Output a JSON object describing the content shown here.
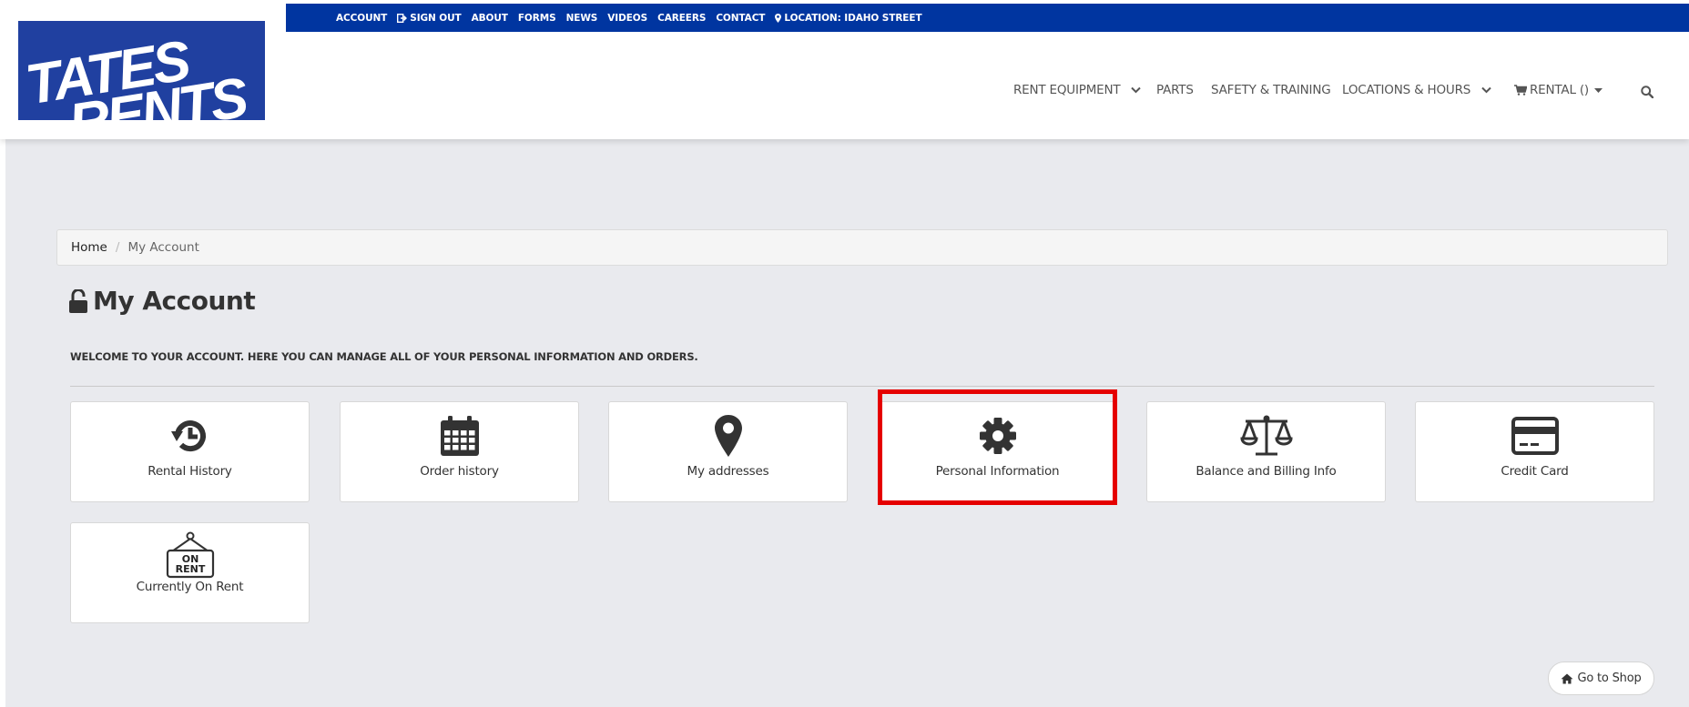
{
  "brand": {
    "logo_text": "TATES RENTS",
    "logo_color": "#2040a0"
  },
  "topbar": {
    "items": [
      "ACCOUNT",
      "SIGN OUT",
      "ABOUT",
      "FORMS",
      "NEWS",
      "VIDEOS",
      "CAREERS",
      "CONTACT",
      "LOCATION: IDAHO STREET"
    ],
    "color": "#0035a0"
  },
  "nav": {
    "rent_equipment": "RENT EQUIPMENT",
    "parts": "PARTS",
    "safety": "SAFETY & TRAINING",
    "locations": "LOCATIONS & HOURS",
    "cart": "RENTAL ()"
  },
  "breadcrumb": {
    "home": "Home",
    "separator": "/",
    "current": "My Account"
  },
  "page": {
    "title": "My Account",
    "welcome": "WELCOME TO YOUR ACCOUNT. HERE YOU CAN MANAGE ALL OF YOUR PERSONAL INFORMATION AND ORDERS."
  },
  "tiles": [
    {
      "label": "Rental History",
      "icon": "history-icon"
    },
    {
      "label": "Order history",
      "icon": "calendar-icon"
    },
    {
      "label": "My addresses",
      "icon": "map-marker-icon"
    },
    {
      "label": "Personal Information",
      "icon": "gear-icon"
    },
    {
      "label": "Balance and Billing Info",
      "icon": "scale-icon"
    },
    {
      "label": "Credit Card",
      "icon": "credit-card-icon"
    },
    {
      "label": "Currently On Rent",
      "icon": "on-rent-sign-icon",
      "sign_text_top": "ON",
      "sign_text_bottom": "RENT"
    }
  ],
  "highlight_color": "#e50000",
  "go_to_shop": "Go to Shop"
}
